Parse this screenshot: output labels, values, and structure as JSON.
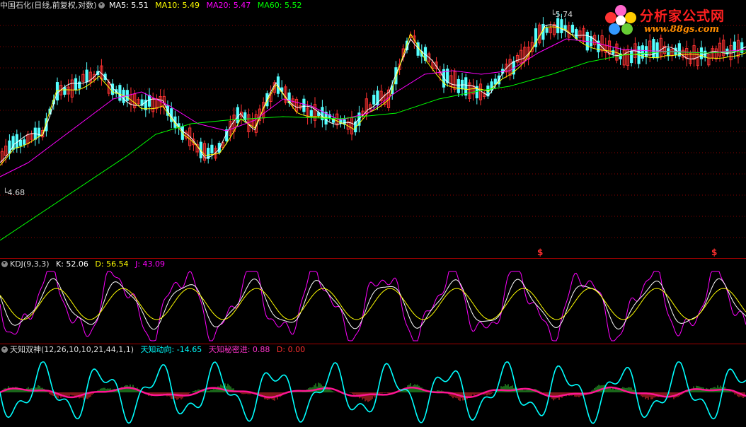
{
  "colors": {
    "background": "#000000",
    "up_candle": "#ff3232",
    "down_candle": "#54ffff",
    "ma5": "#ffffff",
    "ma10": "#ffff00",
    "ma20": "#ff00ff",
    "ma60": "#00ff00",
    "grid": "#8a0000",
    "kdj_k": "#ffffff",
    "kdj_d": "#ffff00",
    "kdj_j": "#ff00ff",
    "tz_line": "#00ffff",
    "tz_pink": "#ff1493"
  },
  "main_panel": {
    "stock_name": "中国石化(日线,前复权,对数)",
    "dropdown_icon": "chevron-down-icon",
    "ma": [
      {
        "label": "MA5: 5.51",
        "color": "#ffffff"
      },
      {
        "label": "MA10: 5.49",
        "color": "#ffff00"
      },
      {
        "label": "MA20: 5.47",
        "color": "#ff00ff"
      },
      {
        "label": "MA60: 5.52",
        "color": "#00ff00"
      }
    ],
    "high_marker": "5.74",
    "low_marker": "4.68",
    "signal_mark": "$"
  },
  "kdj_panel": {
    "name": "KDJ(9,3,3)",
    "k_label": "K: 52.06",
    "d_label": "D: 56.54",
    "j_label": "J: 43.09"
  },
  "tz_panel": {
    "name": "天知双神(12,26,10,10,21,44,1,1)",
    "dongxiang_label": "天知动向: -14.65",
    "mimi_label": "天知秘密进: 0.88",
    "d_label": "D: 0.00"
  },
  "logo": {
    "title": "分析家公式网",
    "url": "www.88gs.com",
    "icon": "flower-icon"
  },
  "chart_data": [
    {
      "type": "candlestick",
      "title": "中国石化(日线,前复权,对数)",
      "annotations": [
        "5.74",
        "4.68"
      ],
      "series": [
        {
          "name": "MA5",
          "last": 5.51
        },
        {
          "name": "MA10",
          "last": 5.49
        },
        {
          "name": "MA20",
          "last": 5.47
        },
        {
          "name": "MA60",
          "last": 5.52
        }
      ],
      "high": 5.74,
      "low": 4.68
    },
    {
      "type": "line",
      "title": "KDJ(9,3,3)",
      "series": [
        {
          "name": "K",
          "last": 52.06
        },
        {
          "name": "D",
          "last": 56.54
        },
        {
          "name": "J",
          "last": 43.09
        }
      ]
    },
    {
      "type": "line",
      "title": "天知双神(12,26,10,10,21,44,1,1)",
      "series": [
        {
          "name": "天知动向",
          "last": -14.65
        },
        {
          "name": "天知秘密进",
          "last": 0.88
        },
        {
          "name": "D",
          "last": 0.0
        }
      ]
    }
  ]
}
